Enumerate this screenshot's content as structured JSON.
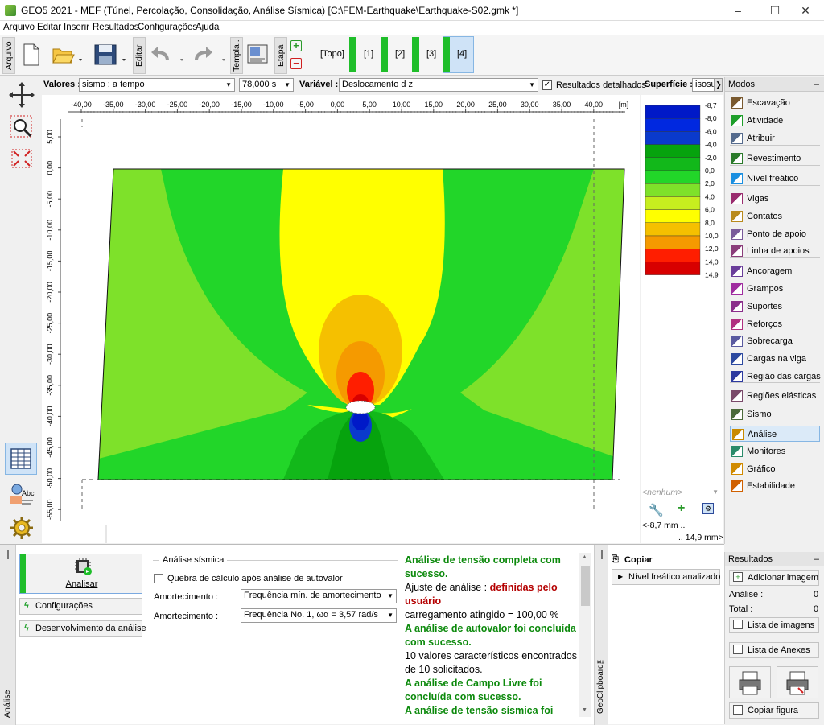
{
  "window": {
    "title": "GEO5 2021 - MEF (Túnel, Percolação, Consolidação, Análise Sísmica) [C:\\FEM-Earthquake\\Earthquake-S02.gmk *]",
    "min": "–",
    "max": "☐",
    "close": "✕"
  },
  "menu": [
    "Arquivo",
    "Editar",
    "Inserir",
    "Resultados",
    "Configurações",
    "Ajuda"
  ],
  "toolbar": {
    "arquivo_tab": "Arquivo",
    "editar_tab": "Editar",
    "templa_tab": "Templa..",
    "etapa_tab": "Etapa",
    "stages": [
      "[Topo]",
      "[1]",
      "[2]",
      "[3]",
      "[4]"
    ]
  },
  "options": {
    "valores_label": "Valores :",
    "valores_value": "sismo : a tempo",
    "time_value": "78,000 s",
    "variavel_label": "Variável :",
    "variavel_value": "Deslocamento d z",
    "detailed_label": "Resultados detalhados",
    "superficie_label": "Superfície :",
    "superficie_value": "isosu"
  },
  "ruler": {
    "x_ticks": [
      "-40,00",
      "-35,00",
      "-30,00",
      "-25,00",
      "-20,00",
      "-15,00",
      "-10,00",
      "-5,00",
      "0,00",
      "5,00",
      "10,00",
      "15,00",
      "20,00",
      "25,00",
      "30,00",
      "35,00",
      "40,00"
    ],
    "x_unit": "[m]",
    "y_ticks": [
      "5,00",
      "0,00",
      "-5,00",
      "-10,00",
      "-15,00",
      "-20,00",
      "-25,00",
      "-30,00",
      "-35,00",
      "-40,00",
      "-45,00",
      "-50,00",
      "-55,00"
    ]
  },
  "legend": {
    "levels": [
      "-8,7",
      "-8,0",
      "-6,0",
      "-4,0",
      "-2,0",
      "0,0",
      "2,0",
      "4,0",
      "6,0",
      "8,0",
      "10,0",
      "12,0",
      "14,0",
      "14,9"
    ],
    "colors": [
      "#0019c8",
      "#0028e0",
      "#0a3acc",
      "#06a30d",
      "#12b81a",
      "#22d629",
      "#7ee12a",
      "#c7ee1f",
      "#ffff00",
      "#f5c000",
      "#f59a00",
      "#ff1e00",
      "#d80000",
      "#b80000"
    ],
    "selector": "<nenhum>",
    "min_text": "<-8,7 mm ..",
    "max_text": ".. 14,9 mm>"
  },
  "modes": {
    "header": "Modos",
    "items": [
      {
        "label": "Escavação",
        "icon": "excavation-icon",
        "color": "#7a5a30"
      },
      {
        "label": "Atividade",
        "icon": "activity-icon",
        "color": "#1e9e2a"
      },
      {
        "label": "Atribuir",
        "icon": "assign-icon",
        "color": "#556b8d"
      },
      {
        "label": "Revestimento",
        "icon": "lining-icon",
        "color": "#2a7a2a"
      },
      {
        "label": "Nível freático",
        "icon": "water-table-icon",
        "color": "#1a8fe0"
      },
      {
        "label": "Vigas",
        "icon": "beams-icon",
        "color": "#9a2d6f"
      },
      {
        "label": "Contatos",
        "icon": "contacts-icon",
        "color": "#b98a1c"
      },
      {
        "label": "Ponto de apoio",
        "icon": "point-support-icon",
        "color": "#7a5a9a"
      },
      {
        "label": "Linha de apoios",
        "icon": "line-support-icon",
        "color": "#8a3d7a"
      },
      {
        "label": "Ancoragem",
        "icon": "anchor-icon",
        "color": "#6a3d9a"
      },
      {
        "label": "Grampos",
        "icon": "nails-icon",
        "color": "#a02da0"
      },
      {
        "label": "Suportes",
        "icon": "props-icon",
        "color": "#8a2d8a"
      },
      {
        "label": "Reforços",
        "icon": "reinforcement-icon",
        "color": "#b03080"
      },
      {
        "label": "Sobrecarga",
        "icon": "surcharge-icon",
        "color": "#5a5aa0"
      },
      {
        "label": "Cargas na viga",
        "icon": "beam-loads-icon",
        "color": "#2d4aa0"
      },
      {
        "label": "Região das cargas",
        "icon": "load-region-icon",
        "color": "#2d3aa0"
      },
      {
        "label": "Regiões elásticas",
        "icon": "elastic-regions-icon",
        "color": "#7a4a6a"
      },
      {
        "label": "Sismo",
        "icon": "earthquake-icon",
        "color": "#4a6a3a"
      },
      {
        "label": "Análise",
        "icon": "analysis-icon",
        "color": "#c98a00"
      },
      {
        "label": "Monitores",
        "icon": "monitors-icon",
        "color": "#2a8a6a"
      },
      {
        "label": "Gráfico",
        "icon": "graph-icon",
        "color": "#d08a00"
      },
      {
        "label": "Estabilidade",
        "icon": "stability-icon",
        "color": "#d06000"
      }
    ]
  },
  "analysis": {
    "side_tab": "Análise",
    "run_button": "Analisar",
    "config_button": "Configurações",
    "dev_button": "Desenvolvimento da análise",
    "group_title": "Análise sísmica",
    "checkbox_label": "Quebra de cálculo após análise de autovalor",
    "damping1_label": "Amortecimento :",
    "damping1_value": "Frequência mín. de amortecimento",
    "damping2_label": "Amortecimento :",
    "damping2_value": "Frequência No. 1, ωα = 3,57 rad/s"
  },
  "messages": [
    {
      "text": "Análise de tensão completa com sucesso.",
      "style": "g"
    },
    {
      "text": "Ajuste de análise : ",
      "bold": "definidas pelo usuário",
      "style": "mix"
    },
    {
      "text": "carregamento atingido = 100,00 %",
      "style": "n"
    },
    {
      "text": "A análise de autovalor foi concluída com sucesso.",
      "style": "g"
    },
    {
      "text": "10 valores característicos encontrados de 10 solicitados.",
      "style": "n"
    },
    {
      "text": "A análise de Campo Livre foi concluída com sucesso.",
      "style": "g"
    },
    {
      "text": "A análise de tensão sísmica foi",
      "style": "g"
    }
  ],
  "clipboard": {
    "side_tab": "GeoClipboard™",
    "copy_label": "Copiar",
    "water_button": "Nível freático analizado"
  },
  "results": {
    "header": "Resultados",
    "add_image": "Adicionar imagem",
    "analise_label": "Análise :",
    "analise_value": "0",
    "total_label": "Total :",
    "total_value": "0",
    "image_list": "Lista de imagens",
    "annex_list": "Lista de Anexes",
    "copy_figure": "Copiar figura"
  }
}
